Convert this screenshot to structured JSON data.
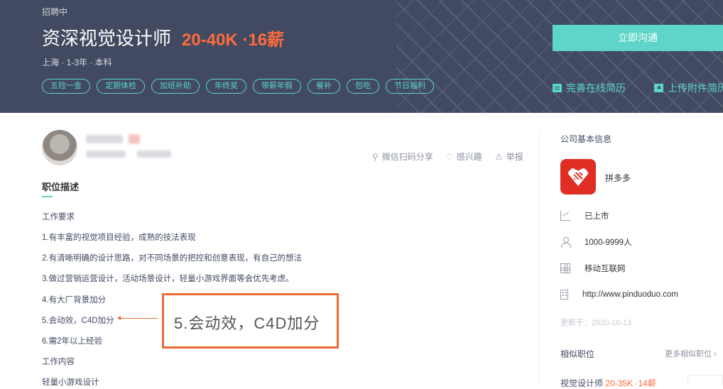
{
  "header": {
    "status": "招聘中",
    "title": "资深视觉设计师",
    "salary": "20-40K ·16薪",
    "meta": "上海 · 1-3年 · 本科",
    "tags": [
      "五险一金",
      "定期体检",
      "加班补助",
      "年终奖",
      "带薪年假",
      "餐补",
      "包吃",
      "节日福利"
    ],
    "apply_label": "立即沟通",
    "resume_label": "完善在线简历",
    "upload_label": "上传附件简历"
  },
  "actions": {
    "share_label": "微信扫码分享",
    "interest_label": "感兴趣",
    "report_label": "举报"
  },
  "description": {
    "title": "职位描述",
    "lines": [
      "工作要求",
      "1.有丰富的视觉项目经验，成熟的技法表现",
      "2.有清晰明确的设计思路，对不同场景的把控和创意表现，有自己的想法",
      "3.做过营销运营设计，活动场景设计，轻量小游戏界面等会优先考虑。",
      "4.有大厂背景加分",
      "5.会动效，C4D加分",
      "6.需2年以上经验",
      "工作内容",
      "轻量小游戏设计"
    ]
  },
  "callout": {
    "text": "5.会动效，C4D加分",
    "color": "#ee6b33"
  },
  "company": {
    "section_title": "公司基本信息",
    "name": "拼多多",
    "stage": "已上市",
    "size": "1000-9999人",
    "industry": "移动互联网",
    "website": "http://www.pinduoduo.com",
    "updated": "更新于：2020-10-13"
  },
  "similar": {
    "title": "相似职位",
    "more_label": "更多相似职位",
    "jobs": [
      {
        "title": "视觉设计师",
        "salary": "20-35K ·14薪"
      }
    ]
  },
  "colors": {
    "header_bg": "#414a60",
    "accent": "#5dd5c8",
    "salary": "#ff6a3d"
  }
}
